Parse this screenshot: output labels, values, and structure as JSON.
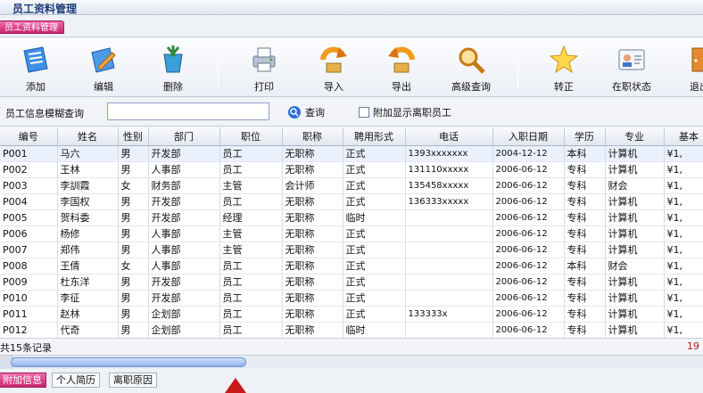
{
  "window": {
    "title": "员工资料管理"
  },
  "tab": {
    "label": "员工资料管理"
  },
  "toolbar": {
    "buttons": [
      {
        "label": "添加",
        "icon": "add-icon"
      },
      {
        "label": "编辑",
        "icon": "edit-icon"
      },
      {
        "label": "删除",
        "icon": "delete-icon"
      },
      {
        "label": "打印",
        "icon": "print-icon"
      },
      {
        "label": "导入",
        "icon": "import-icon"
      },
      {
        "label": "导出",
        "icon": "export-icon"
      },
      {
        "label": "高级查询",
        "icon": "advanced-search-icon"
      },
      {
        "label": "转正",
        "icon": "star-icon"
      },
      {
        "label": "在职状态",
        "icon": "id-card-icon"
      },
      {
        "label": "退出",
        "icon": "exit-icon"
      }
    ]
  },
  "search": {
    "label": "员工信息模糊查询",
    "value": "",
    "query_label": "查询",
    "show_resigned_label": "附加显示离职员工"
  },
  "table": {
    "columns": [
      "编号",
      "姓名",
      "性别",
      "部门",
      "职位",
      "职称",
      "聘用形式",
      "电话",
      "入职日期",
      "学历",
      "专业",
      "基本"
    ],
    "rows": [
      [
        "P001",
        "马六",
        "男",
        "开发部",
        "员工",
        "无职称",
        "正式",
        "1393xxxxxxx",
        "2004-12-12",
        "本科",
        "计算机",
        "¥1,"
      ],
      [
        "P002",
        "王林",
        "男",
        "人事部",
        "员工",
        "无职称",
        "正式",
        "131110xxxxx",
        "2006-06-12",
        "专科",
        "计算机",
        "¥1,"
      ],
      [
        "P003",
        "李訓霞",
        "女",
        "财务部",
        "主管",
        "会计师",
        "正式",
        "135458xxxxx",
        "2006-06-12",
        "专科",
        "财会",
        "¥1,"
      ],
      [
        "P004",
        "李国权",
        "男",
        "开发部",
        "员工",
        "无职称",
        "正式",
        "136333xxxxx",
        "2006-06-12",
        "专科",
        "计算机",
        "¥1,"
      ],
      [
        "P005",
        "贺科委",
        "男",
        "开发部",
        "经理",
        "无职称",
        "临时",
        "",
        "2006-06-12",
        "专科",
        "计算机",
        "¥1,"
      ],
      [
        "P006",
        "杨修",
        "男",
        "人事部",
        "主管",
        "无职称",
        "正式",
        "",
        "2006-06-12",
        "专科",
        "计算机",
        "¥1,"
      ],
      [
        "P007",
        "郑伟",
        "男",
        "人事部",
        "主管",
        "无职称",
        "正式",
        "",
        "2006-06-12",
        "专科",
        "计算机",
        "¥1,"
      ],
      [
        "P008",
        "王倩",
        "女",
        "人事部",
        "员工",
        "无职称",
        "正式",
        "",
        "2006-06-12",
        "本科",
        "财会",
        "¥1,"
      ],
      [
        "P009",
        "杜东洋",
        "男",
        "开发部",
        "员工",
        "无职称",
        "正式",
        "",
        "2006-06-12",
        "专科",
        "计算机",
        "¥1,"
      ],
      [
        "P010",
        "李征",
        "男",
        "开发部",
        "员工",
        "无职称",
        "正式",
        "",
        "2006-06-12",
        "专科",
        "计算机",
        "¥1,"
      ],
      [
        "P011",
        "赵林",
        "男",
        "企划部",
        "员工",
        "无职称",
        "正式",
        "133333x",
        "2006-06-12",
        "专科",
        "计算机",
        "¥1,"
      ],
      [
        "P012",
        "代奇",
        "男",
        "企划部",
        "员工",
        "无职称",
        "临时",
        "",
        "2006-06-12",
        "专科",
        "计算机",
        "¥1,"
      ]
    ]
  },
  "status": {
    "count_text": "共15条记录",
    "right_text": "19"
  },
  "bottom_tabs": [
    "附加信息",
    "个人简历",
    "离职原因"
  ]
}
